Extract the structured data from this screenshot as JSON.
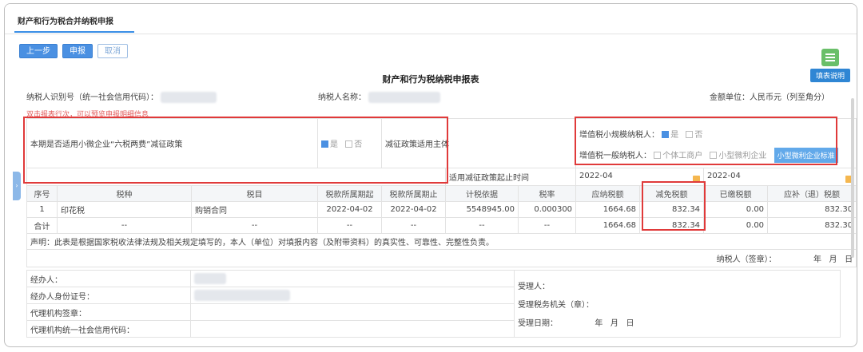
{
  "tab": {
    "label": "财产和行为税合并纳税申报"
  },
  "toolbar": {
    "prev": "上一步",
    "submit": "申报",
    "cancel": "取消"
  },
  "form": {
    "title": "财产和行为税纳税申报表",
    "help": "填表说明",
    "taxpayer_id_label": "纳税人识别号（统一社会信用代码）：",
    "taxpayer_name_label": "纳税人名称：",
    "amount_unit": "金额单位：人民币元（列至角分）",
    "hint": "双击报表行次，可以预览申报明细信息"
  },
  "policy": {
    "six_tax_label": "本期是否适用小微企业“六税两费”减征政策",
    "yes": "是",
    "no": "否",
    "subject_label": "减征政策适用主体",
    "period_label": "适用减征政策起止时间",
    "small_scale_label": "增值税小规模纳税人：",
    "general_label": "增值税一般纳税人：",
    "individual": "个体工商户",
    "micro": "小型微利企业",
    "micro_standard": "小型微利企业标准",
    "start": "2022-04",
    "end": "2022-04"
  },
  "table": {
    "headers": [
      "序号",
      "税种",
      "税目",
      "税款所属期起",
      "税款所属期止",
      "计税依据",
      "税率",
      "应纳税额",
      "减免税额",
      "已缴税额",
      "应补（退）税额"
    ],
    "row": {
      "no": "1",
      "tax": "印花税",
      "item": "购销合同",
      "from": "2022-04-02",
      "to": "2022-04-02",
      "basis": "5548945.00",
      "rate": "0.000300",
      "payable": "1664.68",
      "relief": "832.34",
      "paid": "0.00",
      "due": "832.30"
    },
    "total": {
      "label": "合计",
      "dash": "--",
      "payable": "1664.68",
      "relief": "832.34",
      "paid": "0.00",
      "due": "832.30"
    }
  },
  "declaration": {
    "text": "声明：此表是根据国家税收法律法规及相关规定填写的，本人（单位）对填报内容（及附带资料）的真实性、可靠性、完整性负责。",
    "sign": "纳税人（签章）：",
    "year": "年",
    "month": "月",
    "day": "日"
  },
  "lower": {
    "handler": "经办人：",
    "handler_id": "经办人身份证号：",
    "agency_seal": "代理机构签章：",
    "agency_code": "代理机构统一社会信用代码：",
    "receiver": "受理人：",
    "office": "受理税务机关（章）：",
    "date": "受理日期：",
    "year": "年",
    "month": "月",
    "day": "日"
  },
  "colors": {
    "accent": "#4a90e2",
    "highlight": "#e03a3a",
    "hint": "#e25c5c"
  }
}
